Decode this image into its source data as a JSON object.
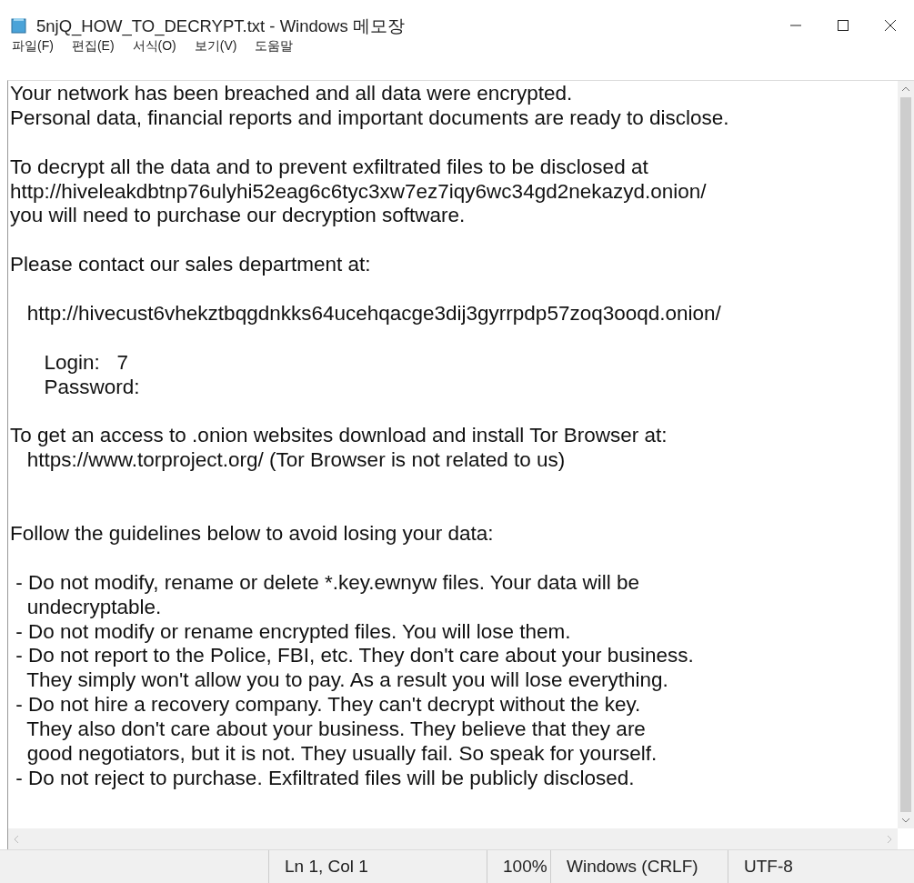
{
  "window": {
    "title": "5njQ_HOW_TO_DECRYPT.txt - Windows 메모장"
  },
  "menu": [
    "파일(F)",
    "편집(E)",
    "서식(O)",
    "보기(V)",
    "도움말"
  ],
  "document": {
    "lines": [
      {
        "kind": "text",
        "text": "Your network has been breached and all data were encrypted."
      },
      {
        "kind": "text",
        "text": "Personal data, financial reports and important documents are ready to disclose."
      },
      {
        "kind": "blank"
      },
      {
        "kind": "text",
        "text": "To decrypt all the data and to prevent exfiltrated files to be disclosed at"
      },
      {
        "kind": "text",
        "text": "http://hiveleakdbtnp76ulyhi52eag6c6tyc3xw7ez7iqy6wc34gd2nekazyd.onion/"
      },
      {
        "kind": "text",
        "text": "you will need to purchase our decryption software."
      },
      {
        "kind": "blank"
      },
      {
        "kind": "text",
        "text": "Please contact our sales department at:"
      },
      {
        "kind": "blank"
      },
      {
        "kind": "text",
        "text": "   http://hivecust6vhekztbqgdnkks64ucehqacge3dij3gyrrpdp57zoq3ooqd.onion/"
      },
      {
        "kind": "blank"
      },
      {
        "kind": "text",
        "text": "      Login:   7"
      },
      {
        "kind": "text",
        "text": "      Password:"
      },
      {
        "kind": "blank"
      },
      {
        "kind": "text",
        "text": "To get an access to .onion websites download and install Tor Browser at:"
      },
      {
        "kind": "text",
        "text": "   https://www.torproject.org/ (Tor Browser is not related to us)"
      },
      {
        "kind": "blank"
      },
      {
        "kind": "blank"
      },
      {
        "kind": "text",
        "text": "Follow the guidelines below to avoid losing your data:"
      },
      {
        "kind": "blank"
      },
      {
        "kind": "text",
        "text": " - Do not modify, rename or delete *.key.ewnyw files. Your data will be"
      },
      {
        "kind": "text",
        "text": "   undecryptable."
      },
      {
        "kind": "text",
        "text": " - Do not modify or rename encrypted files. You will lose them."
      },
      {
        "kind": "text",
        "text": " - Do not report to the Police, FBI, etc. They don't care about your business."
      },
      {
        "kind": "text",
        "text": "   They simply won't allow you to pay. As a result you will lose everything."
      },
      {
        "kind": "text",
        "text": " - Do not hire a recovery company. They can't decrypt without the key."
      },
      {
        "kind": "text",
        "text": "   They also don't care about your business. They believe that they are"
      },
      {
        "kind": "text",
        "text": "   good negotiators, but it is not. They usually fail. So speak for yourself."
      },
      {
        "kind": "text",
        "text": " - Do not reject to purchase. Exfiltrated files will be publicly disclosed."
      }
    ]
  },
  "status_bar": {
    "position": "Ln 1, Col 1",
    "zoom": "100%",
    "line_endings": "Windows (CRLF)",
    "encoding": "UTF-8"
  }
}
